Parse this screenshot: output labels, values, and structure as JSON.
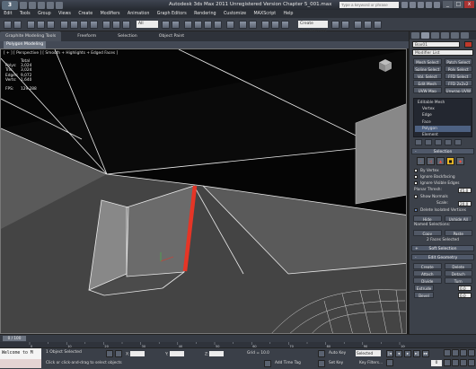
{
  "app": {
    "logo": "3",
    "title": "Autodesk 3ds Max 2011     Unregistered Version     Chapter 5_001.max",
    "search_placeholder": "Type a keyword or phrase",
    "min": "_",
    "max": "□",
    "close": "x"
  },
  "menu": [
    "Edit",
    "Tools",
    "Group",
    "Views",
    "Create",
    "Modifiers",
    "Animation",
    "Graph Editors",
    "Rendering",
    "Customize",
    "MAXScript",
    "Help"
  ],
  "toolbar": {
    "selection_filter": "All",
    "view_dropdown": "View",
    "named_selection": "Create Selection Set"
  },
  "ribbon": {
    "tabs": [
      "Graphite Modeling Tools",
      "Freeform",
      "Selection",
      "Object Paint"
    ],
    "panel_button": "Polygon Modeling"
  },
  "viewport": {
    "label": "[ + ] [ Perspective ] [ Smooth + Highlights + Edged Faces ]",
    "stats_header": "Total",
    "stats": [
      {
        "k": "Polys:",
        "v": "3,024"
      },
      {
        "k": "Tris:",
        "v": "3,024"
      },
      {
        "k": "Edges:",
        "v": "9,072"
      },
      {
        "k": "Verts:",
        "v": "1,640"
      }
    ],
    "fps_label": "FPS:",
    "fps_value": "129.288",
    "colors": {
      "selected_edge": "#e53526",
      "edge": "#ffffff",
      "face": "#6f6f6f"
    }
  },
  "command_panel": {
    "object_name": "Box01",
    "modifier_list": "Modifier List",
    "mod_buttons": [
      "Mesh Select",
      "Patch Select",
      "Spline Select",
      "Poly Select",
      "Vol. Select",
      "FFD Select",
      "Edit Mesh",
      "FFD 2x2x2",
      "UVW Map",
      "Unwrap UVW"
    ],
    "stack": [
      {
        "label": "Editable Mesh",
        "sub": false,
        "hl": false
      },
      {
        "label": "Vertex",
        "sub": true,
        "hl": false
      },
      {
        "label": "Edge",
        "sub": true,
        "hl": false
      },
      {
        "label": "Face",
        "sub": true,
        "hl": false
      },
      {
        "label": "Polygon",
        "sub": true,
        "hl": true
      },
      {
        "label": "Element",
        "sub": true,
        "hl": false
      }
    ],
    "selection_rollout": "Selection",
    "subobj_icons": [
      "vertex-icon",
      "edge-icon",
      "face-icon",
      "polygon-icon",
      "element-icon"
    ],
    "by_vertex": "By Vertex",
    "ignore_backfacing": "Ignore Backfacing",
    "ignore_visible_edges": "Ignore Visible Edges",
    "planar_thresh_label": "Planar Thresh:",
    "planar_thresh_value": "45.0",
    "show_normals": "Show Normals",
    "scale_label": "Scale:",
    "scale_value": "20.0",
    "delete_isolated": "Delete Isolated Vertices",
    "hide": "Hide",
    "unhide_all": "Unhide All",
    "named_selections": "Named Selections:",
    "copy": "Copy",
    "paste": "Paste",
    "faces_selected": "2 Faces Selected",
    "soft_selection": "Soft Selection",
    "edit_geometry": "Edit Geometry",
    "create": "Create",
    "delete": "Delete",
    "attach": "Attach",
    "detach": "Detach",
    "divide": "Divide",
    "turn": "Turn",
    "extrude_label": "Extrude",
    "extrude_value": "0.0",
    "bevel_label": "Bevel",
    "bevel_value": "0.0"
  },
  "trackbar": {
    "time_slider": "0 / 100",
    "ticks": [
      "0",
      "10",
      "20",
      "30",
      "40",
      "50",
      "60",
      "70",
      "80",
      "90",
      "100"
    ]
  },
  "status": {
    "maxscript": "Welcome to M",
    "objects_selected": "1 Object Selected",
    "prompt": "Click or click-and-drag to select objects",
    "x_label": "X:",
    "y_label": "Y:",
    "z_label": "Z:",
    "grid": "Grid = 10.0",
    "add_time_tag": "Add Time Tag",
    "auto_key": "Auto Key",
    "selected": "Selected",
    "set_key": "Set Key",
    "key_filters": "Key Filters...",
    "frame": "0"
  }
}
